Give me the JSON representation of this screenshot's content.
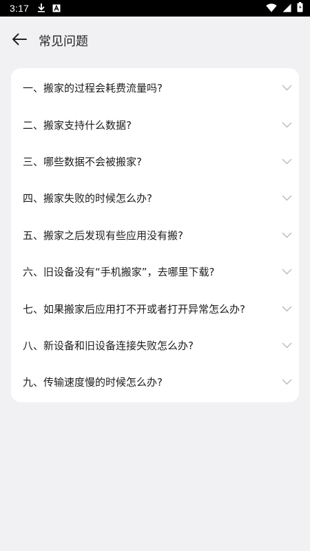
{
  "status_bar": {
    "time": "3:17",
    "icons_left": [
      "download-icon",
      "a-box-icon"
    ],
    "icons_right": [
      "wifi-icon",
      "signal-icon",
      "battery-icon"
    ]
  },
  "header": {
    "title": "常见问题",
    "back_icon": "arrow-left-icon"
  },
  "faq": {
    "items": [
      {
        "label": "一、搬家的过程会耗费流量吗?"
      },
      {
        "label": "二、搬家支持什么数据?"
      },
      {
        "label": "三、哪些数据不会被搬家?"
      },
      {
        "label": "四、搬家失败的时候怎么办?"
      },
      {
        "label": "五、搬家之后发现有些应用没有搬?"
      },
      {
        "label": "六、旧设备没有“手机搬家”，去哪里下载?"
      },
      {
        "label": "七、如果搬家后应用打不开或者打开异常怎么办?"
      },
      {
        "label": "八、新设备和旧设备连接失败怎么办?"
      },
      {
        "label": "九、传输速度慢的时候怎么办?"
      }
    ]
  },
  "colors": {
    "background": "#f1f1f3",
    "card": "#ffffff",
    "chevron": "#b9b9b9",
    "status_bar": "#000000"
  }
}
